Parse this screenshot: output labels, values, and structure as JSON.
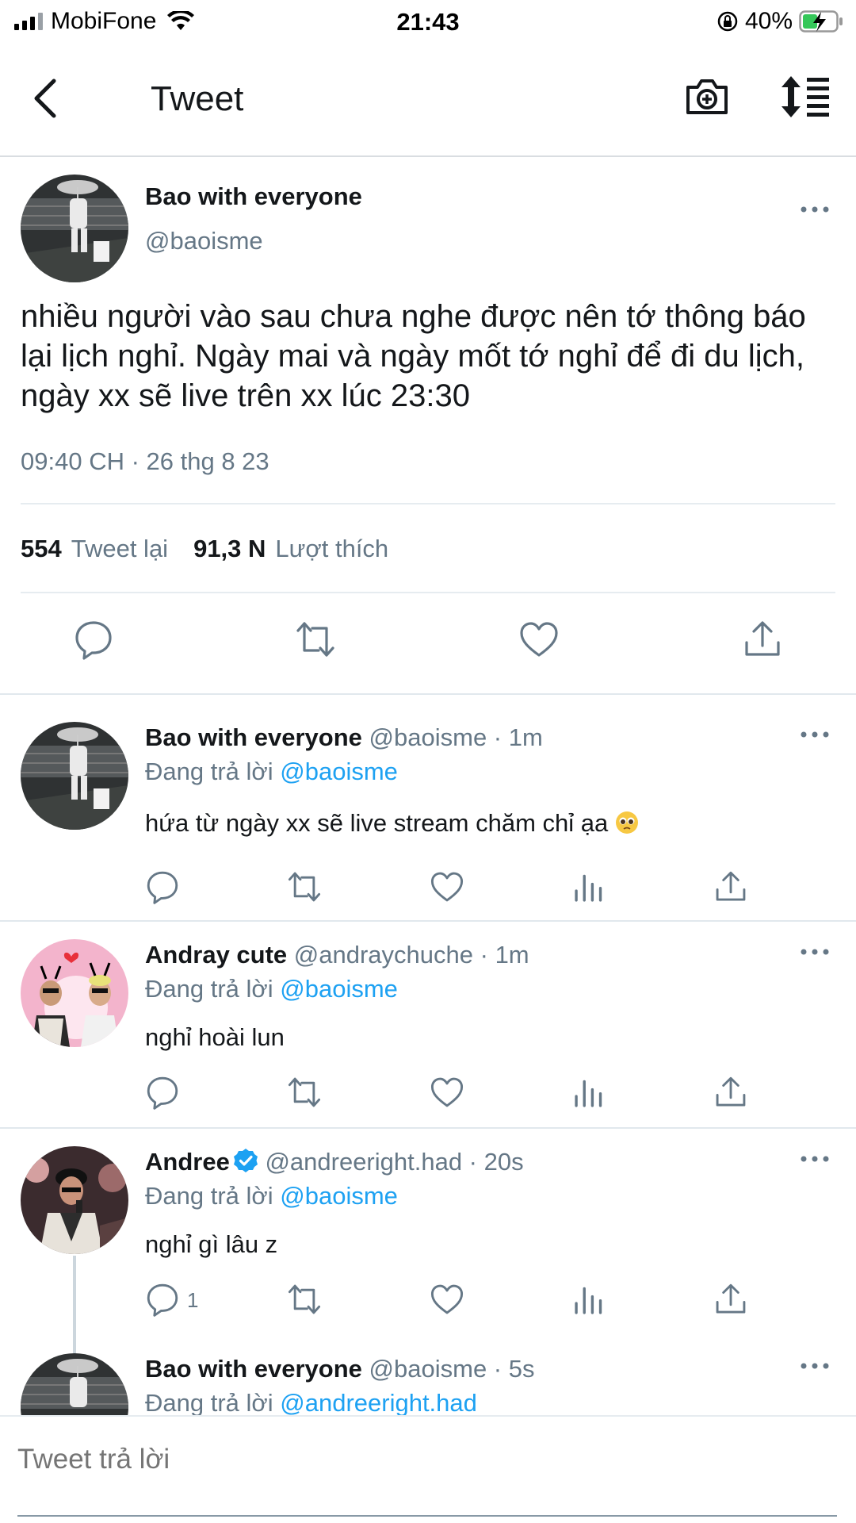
{
  "status_bar": {
    "carrier": "MobiFone",
    "time": "21:43",
    "battery": "40%"
  },
  "nav": {
    "title": "Tweet",
    "icons": [
      "back-arrow-icon",
      "camera-plus-icon",
      "sort-icon"
    ]
  },
  "main_tweet": {
    "name": "Bao with everyone",
    "handle": "@baoisme",
    "text": "nhiều người vào sau chưa nghe được nên tớ thông báo lại lịch nghỉ. Ngày mai và ngày mốt tớ nghỉ để đi du lịch, ngày xx sẽ live trên xx lúc 23:30",
    "timestamp": "09:40 CH · 26 thg 8 23",
    "retweets_count": "554",
    "retweets_label": "Tweet lại",
    "likes_count": "91,3 N",
    "likes_label": "Lượt thích"
  },
  "replies": [
    {
      "name": "Bao with everyone",
      "meta": "@baoisme · 1m",
      "replying_to_label": "Đang trả lời",
      "replying_to": "@baoisme",
      "text": "hứa từ ngày xx sẽ live stream chăm chỉ ạa",
      "emoji": "pleading-face-emoji",
      "reply_count": ""
    },
    {
      "name": "Andray cute",
      "meta": "@andraychuche · 1m",
      "replying_to_label": "Đang trả lời",
      "replying_to": "@baoisme",
      "text": "nghỉ hoài lun",
      "reply_count": ""
    },
    {
      "name": "Andree",
      "meta": "@andreeright.had · 20s",
      "replying_to_label": "Đang trả lời",
      "replying_to": "@baoisme",
      "text": "nghỉ gì lâu z",
      "verified": true,
      "reply_count": "1"
    },
    {
      "name": "Bao with everyone",
      "meta": "@baoisme · 5s",
      "replying_to_label": "Đang trả lời",
      "replying_to": "@andreeright.had",
      "text": ""
    }
  ],
  "composer": {
    "placeholder": "Tweet trả lời"
  },
  "colors": {
    "link": "#1da1f2",
    "secondary_text": "#657786",
    "divider": "#e6ecf0"
  }
}
